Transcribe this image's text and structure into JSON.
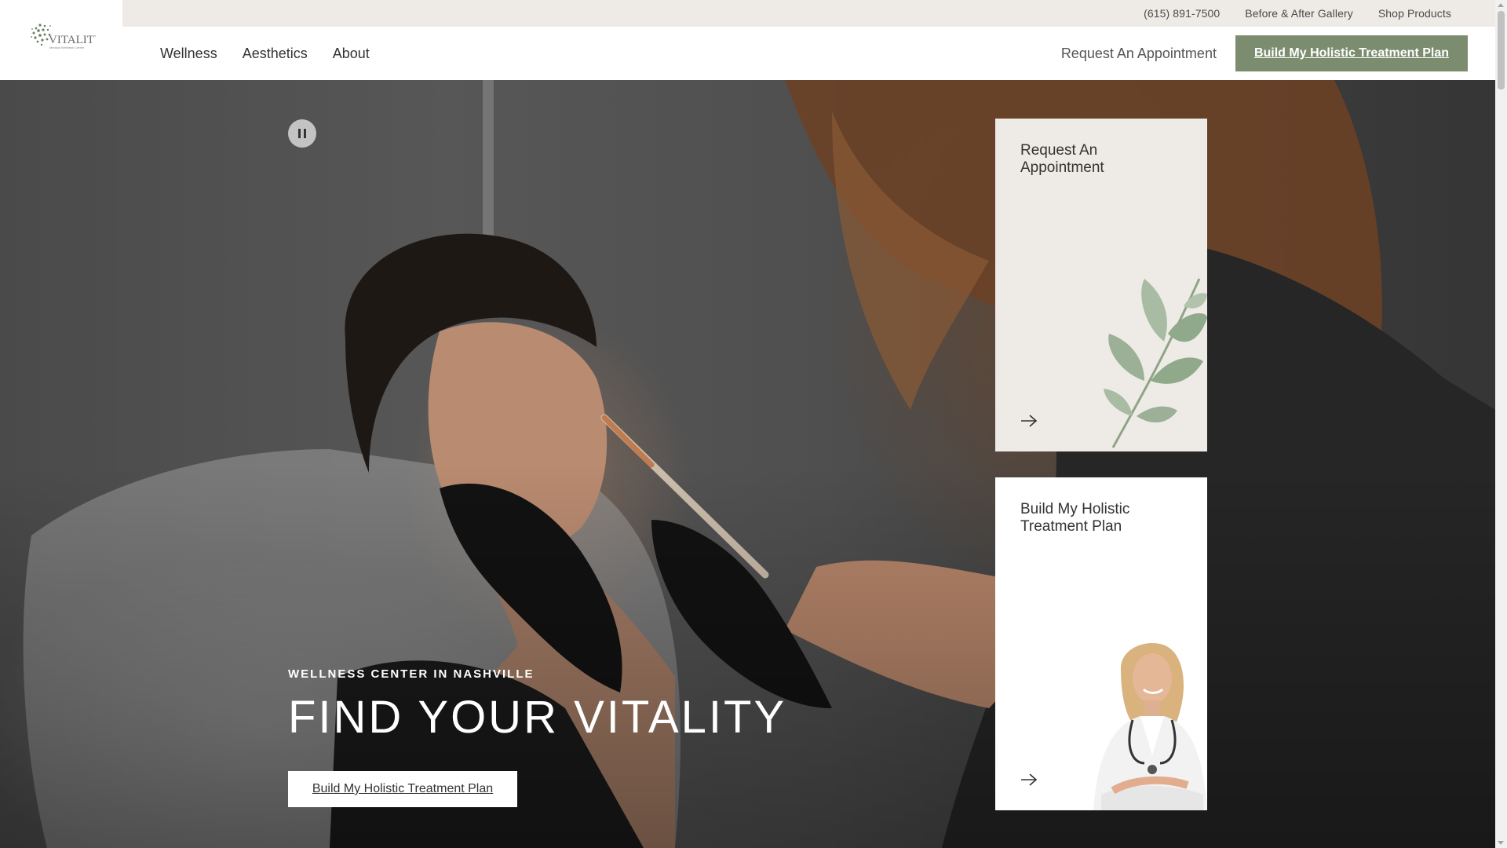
{
  "brand": {
    "logo_text": "VITALITY",
    "logo_tagline": "Medical Wellness Center",
    "accent": "#7b8d6e"
  },
  "utility": {
    "phone": "(615) 891-7500",
    "gallery": "Before & After Gallery",
    "shop": "Shop Products"
  },
  "nav": {
    "items": [
      {
        "label": "Wellness"
      },
      {
        "label": "Aesthetics"
      },
      {
        "label": "About"
      }
    ],
    "appointment": "Request An Appointment",
    "cta": "Build My Holistic Treatment Plan"
  },
  "hero": {
    "kicker": "WELLNESS CENTER IN NASHVILLE",
    "title": "FIND YOUR VITALITY",
    "cta": "Build My Holistic Treatment Plan",
    "pause_icon": "pause-icon"
  },
  "cards": [
    {
      "title": "Request An Appointment",
      "icon": "arrow-right-icon"
    },
    {
      "title": "Build My Holistic Treatment Plan",
      "icon": "arrow-right-icon"
    }
  ]
}
